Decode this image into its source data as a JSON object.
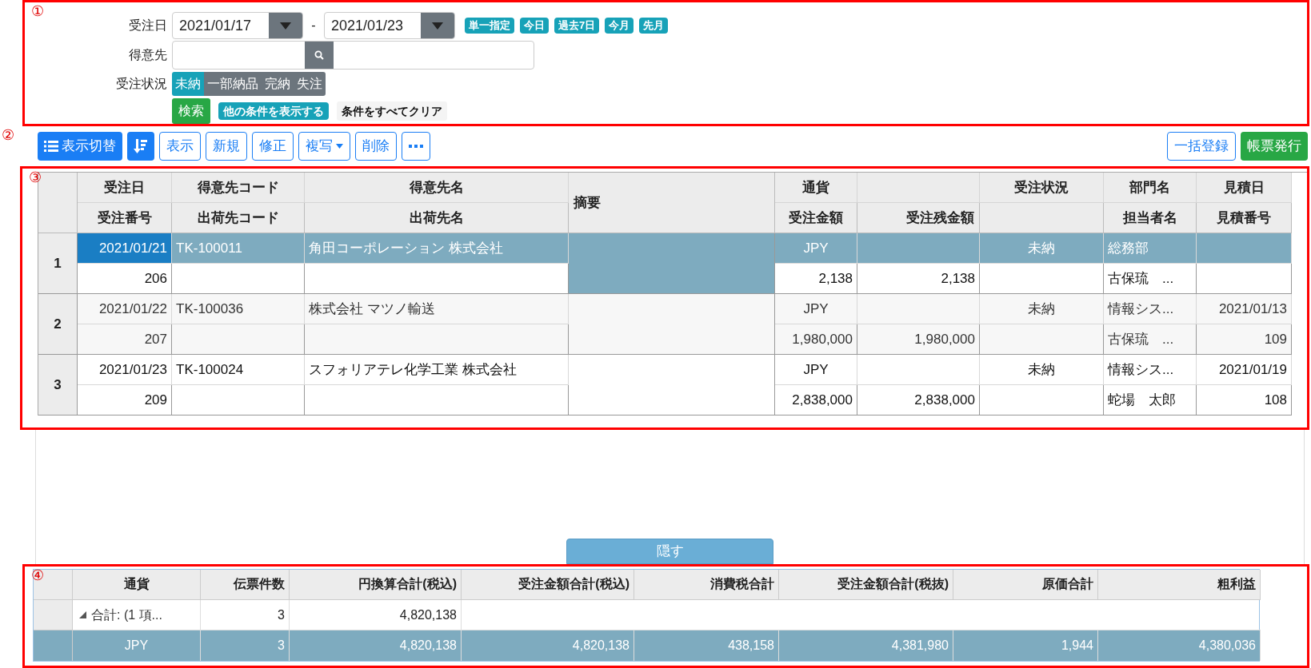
{
  "annotations": [
    "①",
    "②",
    "③",
    "④"
  ],
  "filter": {
    "order_date": {
      "label": "受注日",
      "from": "2021/01/17",
      "separator": "-",
      "to": "2021/01/23",
      "quick": [
        "単一指定",
        "今日",
        "過去7日",
        "今月",
        "先月"
      ]
    },
    "customer": {
      "label": "得意先"
    },
    "status": {
      "label": "受注状況",
      "options": [
        {
          "label": "未納",
          "selected": true
        },
        {
          "label": "一部納品",
          "selected": false
        },
        {
          "label": "完納",
          "selected": false
        },
        {
          "label": "失注",
          "selected": false
        }
      ]
    },
    "actions": [
      {
        "label": "検索",
        "kind": "search"
      },
      {
        "label": "他の条件を表示する",
        "kind": "more"
      },
      {
        "label": "条件をすべてクリア",
        "kind": "clear"
      }
    ]
  },
  "toolbar": {
    "left": [
      {
        "label": "表示切替",
        "kind": "primary-list"
      },
      {
        "kind": "primary-sort"
      },
      {
        "label": "表示",
        "kind": "outline"
      },
      {
        "label": "新規",
        "kind": "outline"
      },
      {
        "label": "修正",
        "kind": "outline"
      },
      {
        "label": "複写",
        "kind": "outline-caret"
      },
      {
        "label": "削除",
        "kind": "outline"
      },
      {
        "kind": "outline-more"
      }
    ],
    "right": [
      {
        "label": "一括登録",
        "kind": "outline"
      },
      {
        "label": "帳票発行",
        "kind": "success"
      }
    ]
  },
  "table": {
    "columns": [
      {
        "kind": "double",
        "top": "受注日",
        "bottom": "受注番号"
      },
      {
        "kind": "double",
        "top": "得意先コード",
        "bottom": "出荷先コード"
      },
      {
        "kind": "double",
        "top": "得意先名",
        "bottom": "出荷先名"
      },
      {
        "kind": "merged",
        "top": "摘要"
      },
      {
        "kind": "double",
        "top": "通貨",
        "bottom": "受注金額"
      },
      {
        "kind": "double",
        "bottom": "受注残金額"
      },
      {
        "kind": "double",
        "top": "受注状況"
      },
      {
        "kind": "double",
        "top": "部門名",
        "bottom": "担当者名"
      },
      {
        "kind": "double",
        "top": "見積日",
        "bottom": "見積番号"
      }
    ],
    "rows": [
      {
        "number": "1",
        "selected": true,
        "top": {
          "order_date": "2021/01/21",
          "customer_code": "TK-100011",
          "customer_name": "角田コーポレーション 株式会社",
          "currency": "JPY",
          "status": "未納",
          "department": "総務部"
        },
        "bottom": {
          "order_no": "206",
          "amount": "2,138",
          "balance": "2,138",
          "person": "古保琉　..."
        }
      },
      {
        "number": "2",
        "selected": false,
        "top": {
          "order_date": "2021/01/22",
          "customer_code": "TK-100036",
          "customer_name": "株式会社 マツノ輸送",
          "currency": "JPY",
          "status": "未納",
          "department": "情報シス...",
          "quote_date": "2021/01/13"
        },
        "bottom": {
          "order_no": "207",
          "amount": "1,980,000",
          "balance": "1,980,000",
          "person": "古保琉　...",
          "quote_no": "109"
        }
      },
      {
        "number": "3",
        "selected": false,
        "top": {
          "order_date": "2021/01/23",
          "customer_code": "TK-100024",
          "customer_name": "スフォリアテレ化学工業 株式会社",
          "currency": "JPY",
          "status": "未納",
          "department": "情報シス...",
          "quote_date": "2021/01/19"
        },
        "bottom": {
          "order_no": "209",
          "amount": "2,838,000",
          "balance": "2,838,000",
          "person": "蛇場　太郎",
          "quote_no": "108"
        }
      }
    ]
  },
  "hide_tab": "隠す",
  "summary": {
    "columns": [
      "通貨",
      "伝票件数",
      "円換算合計(税込)",
      "受注金額合計(税込)",
      "消費税合計",
      "受注金額合計(税抜)",
      "原価合計",
      "粗利益"
    ],
    "group": {
      "expanded": true,
      "label": "合計: (1 項...",
      "count": "3",
      "total": "4,820,138"
    },
    "rows": [
      {
        "selected": true,
        "cells": [
          "JPY",
          "3",
          "4,820,138",
          "4,820,138",
          "438,158",
          "4,381,980",
          "1,944",
          "4,380,036"
        ]
      }
    ]
  }
}
